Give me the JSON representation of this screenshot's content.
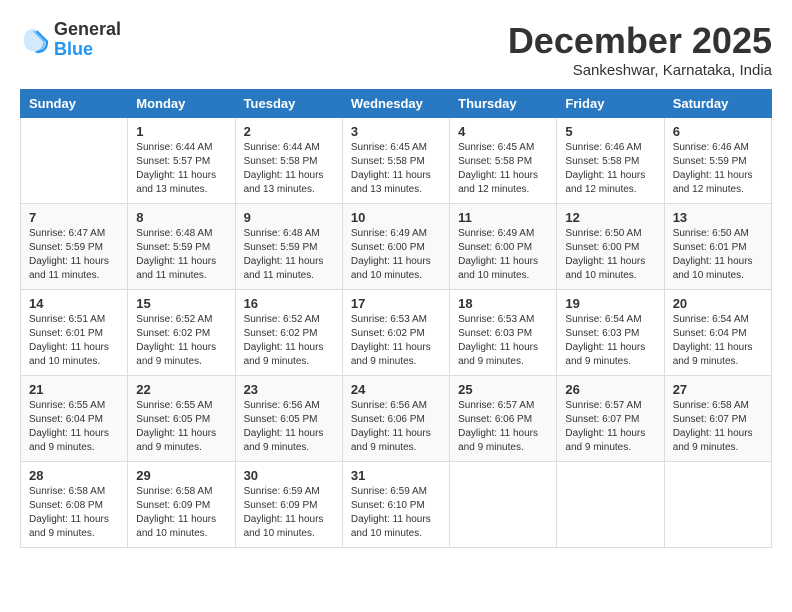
{
  "logo": {
    "general": "General",
    "blue": "Blue"
  },
  "title": "December 2025",
  "location": "Sankeshwar, Karnataka, India",
  "days_of_week": [
    "Sunday",
    "Monday",
    "Tuesday",
    "Wednesday",
    "Thursday",
    "Friday",
    "Saturday"
  ],
  "weeks": [
    [
      {
        "day": "",
        "info": ""
      },
      {
        "day": "1",
        "info": "Sunrise: 6:44 AM\nSunset: 5:57 PM\nDaylight: 11 hours\nand 13 minutes."
      },
      {
        "day": "2",
        "info": "Sunrise: 6:44 AM\nSunset: 5:58 PM\nDaylight: 11 hours\nand 13 minutes."
      },
      {
        "day": "3",
        "info": "Sunrise: 6:45 AM\nSunset: 5:58 PM\nDaylight: 11 hours\nand 13 minutes."
      },
      {
        "day": "4",
        "info": "Sunrise: 6:45 AM\nSunset: 5:58 PM\nDaylight: 11 hours\nand 12 minutes."
      },
      {
        "day": "5",
        "info": "Sunrise: 6:46 AM\nSunset: 5:58 PM\nDaylight: 11 hours\nand 12 minutes."
      },
      {
        "day": "6",
        "info": "Sunrise: 6:46 AM\nSunset: 5:59 PM\nDaylight: 11 hours\nand 12 minutes."
      }
    ],
    [
      {
        "day": "7",
        "info": "Sunrise: 6:47 AM\nSunset: 5:59 PM\nDaylight: 11 hours\nand 11 minutes."
      },
      {
        "day": "8",
        "info": "Sunrise: 6:48 AM\nSunset: 5:59 PM\nDaylight: 11 hours\nand 11 minutes."
      },
      {
        "day": "9",
        "info": "Sunrise: 6:48 AM\nSunset: 5:59 PM\nDaylight: 11 hours\nand 11 minutes."
      },
      {
        "day": "10",
        "info": "Sunrise: 6:49 AM\nSunset: 6:00 PM\nDaylight: 11 hours\nand 10 minutes."
      },
      {
        "day": "11",
        "info": "Sunrise: 6:49 AM\nSunset: 6:00 PM\nDaylight: 11 hours\nand 10 minutes."
      },
      {
        "day": "12",
        "info": "Sunrise: 6:50 AM\nSunset: 6:00 PM\nDaylight: 11 hours\nand 10 minutes."
      },
      {
        "day": "13",
        "info": "Sunrise: 6:50 AM\nSunset: 6:01 PM\nDaylight: 11 hours\nand 10 minutes."
      }
    ],
    [
      {
        "day": "14",
        "info": "Sunrise: 6:51 AM\nSunset: 6:01 PM\nDaylight: 11 hours\nand 10 minutes."
      },
      {
        "day": "15",
        "info": "Sunrise: 6:52 AM\nSunset: 6:02 PM\nDaylight: 11 hours\nand 9 minutes."
      },
      {
        "day": "16",
        "info": "Sunrise: 6:52 AM\nSunset: 6:02 PM\nDaylight: 11 hours\nand 9 minutes."
      },
      {
        "day": "17",
        "info": "Sunrise: 6:53 AM\nSunset: 6:02 PM\nDaylight: 11 hours\nand 9 minutes."
      },
      {
        "day": "18",
        "info": "Sunrise: 6:53 AM\nSunset: 6:03 PM\nDaylight: 11 hours\nand 9 minutes."
      },
      {
        "day": "19",
        "info": "Sunrise: 6:54 AM\nSunset: 6:03 PM\nDaylight: 11 hours\nand 9 minutes."
      },
      {
        "day": "20",
        "info": "Sunrise: 6:54 AM\nSunset: 6:04 PM\nDaylight: 11 hours\nand 9 minutes."
      }
    ],
    [
      {
        "day": "21",
        "info": "Sunrise: 6:55 AM\nSunset: 6:04 PM\nDaylight: 11 hours\nand 9 minutes."
      },
      {
        "day": "22",
        "info": "Sunrise: 6:55 AM\nSunset: 6:05 PM\nDaylight: 11 hours\nand 9 minutes."
      },
      {
        "day": "23",
        "info": "Sunrise: 6:56 AM\nSunset: 6:05 PM\nDaylight: 11 hours\nand 9 minutes."
      },
      {
        "day": "24",
        "info": "Sunrise: 6:56 AM\nSunset: 6:06 PM\nDaylight: 11 hours\nand 9 minutes."
      },
      {
        "day": "25",
        "info": "Sunrise: 6:57 AM\nSunset: 6:06 PM\nDaylight: 11 hours\nand 9 minutes."
      },
      {
        "day": "26",
        "info": "Sunrise: 6:57 AM\nSunset: 6:07 PM\nDaylight: 11 hours\nand 9 minutes."
      },
      {
        "day": "27",
        "info": "Sunrise: 6:58 AM\nSunset: 6:07 PM\nDaylight: 11 hours\nand 9 minutes."
      }
    ],
    [
      {
        "day": "28",
        "info": "Sunrise: 6:58 AM\nSunset: 6:08 PM\nDaylight: 11 hours\nand 9 minutes."
      },
      {
        "day": "29",
        "info": "Sunrise: 6:58 AM\nSunset: 6:09 PM\nDaylight: 11 hours\nand 10 minutes."
      },
      {
        "day": "30",
        "info": "Sunrise: 6:59 AM\nSunset: 6:09 PM\nDaylight: 11 hours\nand 10 minutes."
      },
      {
        "day": "31",
        "info": "Sunrise: 6:59 AM\nSunset: 6:10 PM\nDaylight: 11 hours\nand 10 minutes."
      },
      {
        "day": "",
        "info": ""
      },
      {
        "day": "",
        "info": ""
      },
      {
        "day": "",
        "info": ""
      }
    ]
  ]
}
